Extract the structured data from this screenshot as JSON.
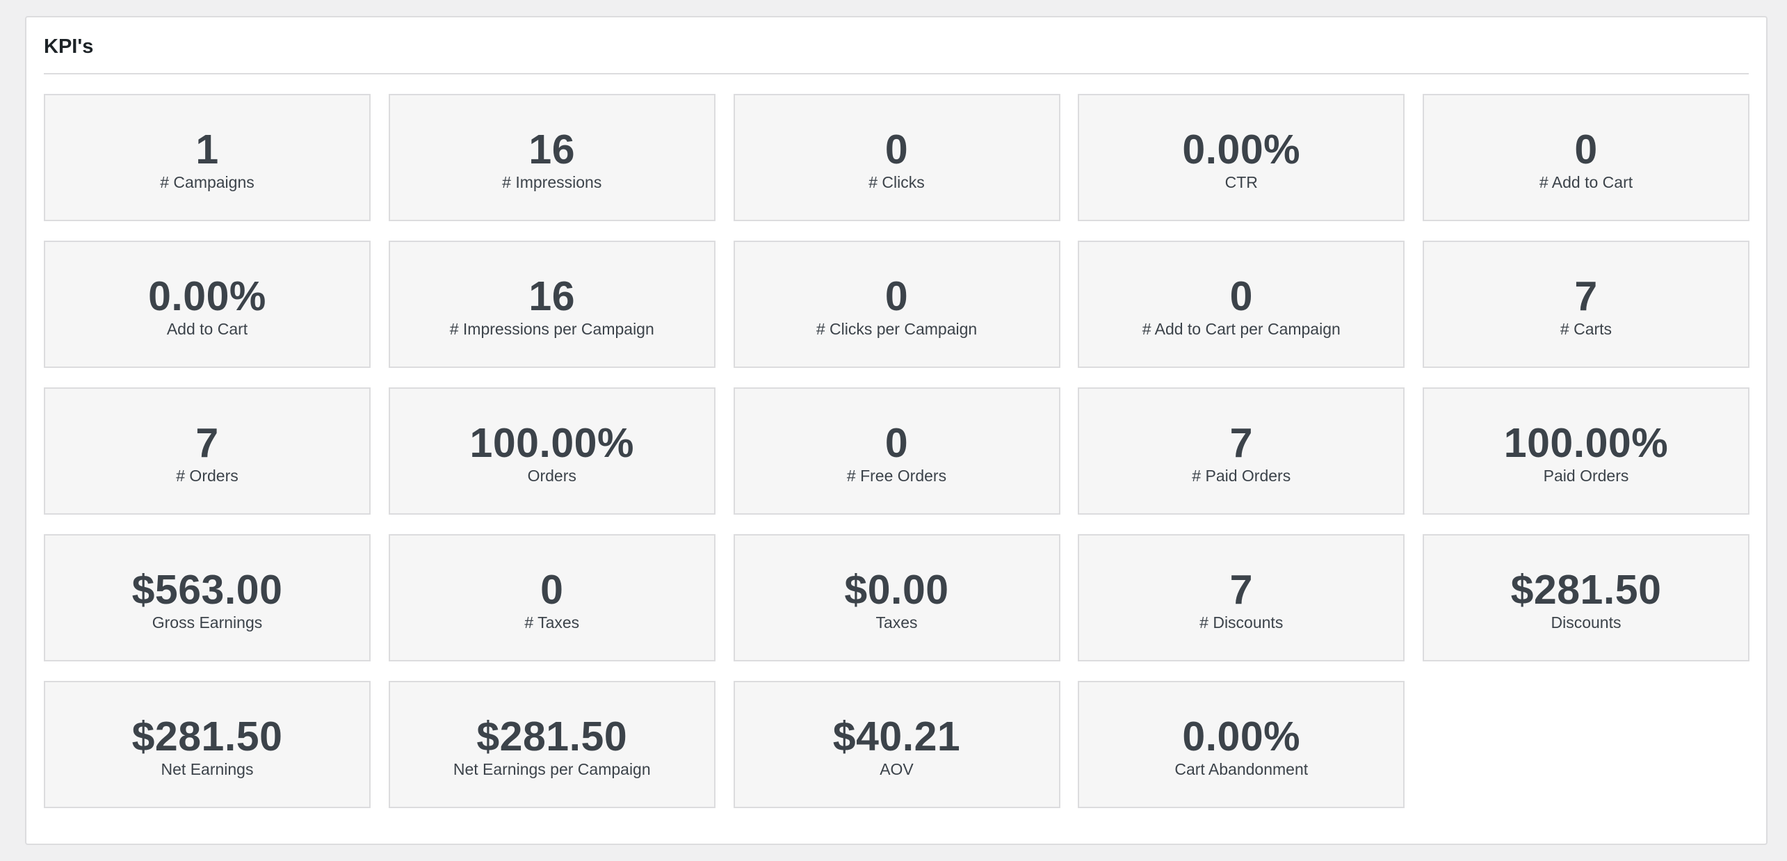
{
  "panel": {
    "title": "KPI's"
  },
  "kpis": [
    {
      "value": "1",
      "label": "# Campaigns"
    },
    {
      "value": "16",
      "label": "# Impressions"
    },
    {
      "value": "0",
      "label": "# Clicks"
    },
    {
      "value": "0.00%",
      "label": "CTR"
    },
    {
      "value": "0",
      "label": "# Add to Cart"
    },
    {
      "value": "0.00%",
      "label": "Add to Cart"
    },
    {
      "value": "16",
      "label": "# Impressions per Campaign"
    },
    {
      "value": "0",
      "label": "# Clicks per Campaign"
    },
    {
      "value": "0",
      "label": "# Add to Cart per Campaign"
    },
    {
      "value": "7",
      "label": "# Carts"
    },
    {
      "value": "7",
      "label": "# Orders"
    },
    {
      "value": "100.00%",
      "label": "Orders"
    },
    {
      "value": "0",
      "label": "# Free Orders"
    },
    {
      "value": "7",
      "label": "# Paid Orders"
    },
    {
      "value": "100.00%",
      "label": "Paid Orders"
    },
    {
      "value": "$563.00",
      "label": "Gross Earnings"
    },
    {
      "value": "0",
      "label": "# Taxes"
    },
    {
      "value": "$0.00",
      "label": "Taxes"
    },
    {
      "value": "7",
      "label": "# Discounts"
    },
    {
      "value": "$281.50",
      "label": "Discounts"
    },
    {
      "value": "$281.50",
      "label": "Net Earnings"
    },
    {
      "value": "$281.50",
      "label": "Net Earnings per Campaign"
    },
    {
      "value": "$40.21",
      "label": "AOV"
    },
    {
      "value": "0.00%",
      "label": "Cart Abandonment"
    }
  ]
}
